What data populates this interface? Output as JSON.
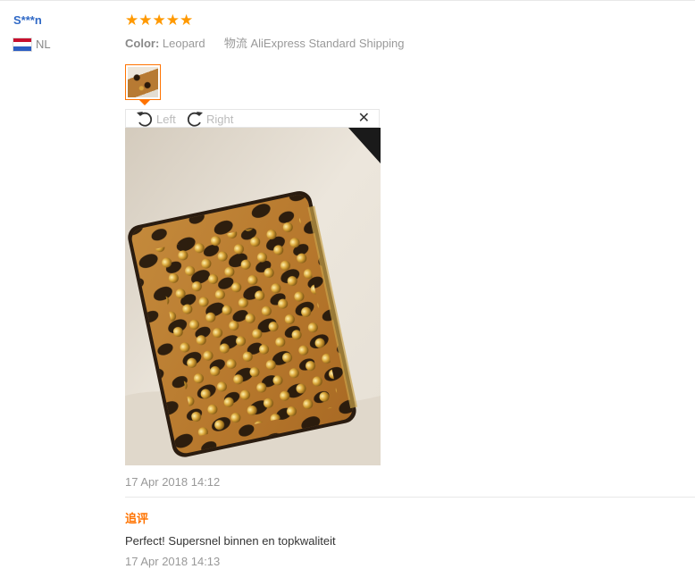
{
  "review": {
    "user_name": "S***n",
    "country_code": "NL",
    "rating_stars": 5,
    "color_label": "Color:",
    "color_value": "Leopard",
    "shipping": "物流 AliExpress Standard Shipping",
    "viewer": {
      "rotate_left_label": "Left",
      "rotate_right_label": "Right",
      "close_glyph": "✕"
    },
    "date": "17 Apr 2018 14:12",
    "followup": {
      "heading": "追评",
      "text": "Perfect! Supersnel binnen en topkwaliteit",
      "date": "17 Apr 2018 14:13"
    }
  },
  "colors": {
    "accent": "#ff7300",
    "star": "#ff9900",
    "user_name": "#3069c6"
  },
  "icons": {
    "rotate_left": "rotate-left-icon",
    "rotate_right": "rotate-right-icon",
    "close": "close-icon",
    "star": "star-icon",
    "flag": "flag-nl-icon"
  }
}
